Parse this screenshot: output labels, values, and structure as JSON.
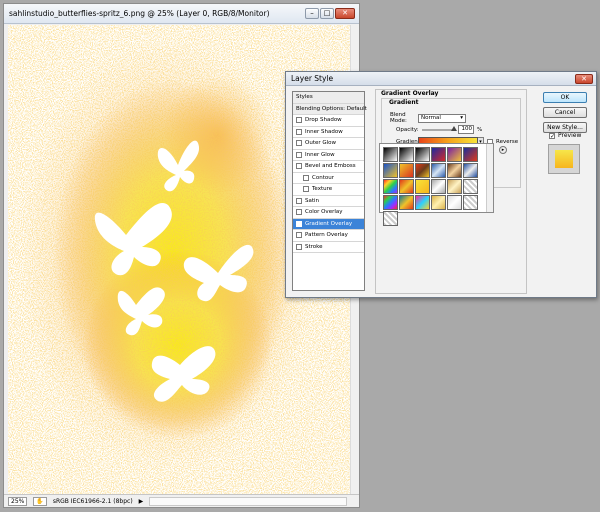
{
  "document": {
    "title": "sahlinstudio_butterflies-spritz_6.png @ 25% (Layer 0, RGB/8/Monitor)",
    "buttons": {
      "minimize": "–",
      "maximize": "□",
      "close": "✕"
    },
    "status": {
      "zoom": "25%",
      "profile": "sRGB IEC61966-2.1 (8bpc)",
      "arrow": "▶"
    }
  },
  "dialog": {
    "title": "Layer Style",
    "close": "✕",
    "styles_header": "Styles",
    "blending_options": "Blending Options: Default",
    "styles": [
      {
        "label": "Drop Shadow",
        "checked": false,
        "sub": false
      },
      {
        "label": "Inner Shadow",
        "checked": false,
        "sub": false
      },
      {
        "label": "Outer Glow",
        "checked": false,
        "sub": false
      },
      {
        "label": "Inner Glow",
        "checked": false,
        "sub": false
      },
      {
        "label": "Bevel and Emboss",
        "checked": false,
        "sub": false
      },
      {
        "label": "Contour",
        "checked": false,
        "sub": true
      },
      {
        "label": "Texture",
        "checked": false,
        "sub": true
      },
      {
        "label": "Satin",
        "checked": false,
        "sub": false
      },
      {
        "label": "Color Overlay",
        "checked": false,
        "sub": false
      },
      {
        "label": "Gradient Overlay",
        "checked": true,
        "sub": false,
        "selected": true
      },
      {
        "label": "Pattern Overlay",
        "checked": false,
        "sub": false
      },
      {
        "label": "Stroke",
        "checked": false,
        "sub": false
      }
    ],
    "panel_title": "Gradient Overlay",
    "group_title": "Gradient",
    "blend_mode_label": "Blend Mode:",
    "blend_mode_value": "Normal",
    "opacity_label": "Opacity:",
    "opacity_value": "100",
    "opacity_unit": "%",
    "gradient_label": "Gradient:",
    "reverse_label": "Reverse",
    "buttons": {
      "ok": "OK",
      "cancel": "Cancel",
      "new_style": "New Style...",
      "preview": "Preview"
    },
    "preview_checked": true,
    "gradient_swatches": [
      "linear-gradient(135deg,#000,#fff)",
      "linear-gradient(135deg,#000,#fff)",
      "linear-gradient(135deg,#000,transparent)",
      "linear-gradient(135deg,#1c2aa0,#d42b2b)",
      "linear-gradient(135deg,#7a1fa2,#f0c13a)",
      "linear-gradient(135deg,#1a2d9a,#e03a1a)",
      "linear-gradient(135deg,#1a54c9,#f0c22a)",
      "linear-gradient(135deg,#f0c22a,#d9331f)",
      "linear-gradient(135deg,#e03a1a,#6b3d1d,#f0c22a)",
      "linear-gradient(135deg,#2b5ba8,#d6e5f5,#2b5ba8)",
      "linear-gradient(135deg,#6b3d1d,#f3d2a0,#6b3d1d)",
      "linear-gradient(135deg,#2450a0,#eee,#2450a0)",
      "linear-gradient(135deg,#ff2a2a,#ffd22a,#2ad24a,#2a7aff,#a02aff)",
      "linear-gradient(135deg,#e03a1a,#f0c22a,#e03a1a)",
      "linear-gradient(135deg,#f7e33a,#f7b51d)",
      "linear-gradient(135deg,#a8a8a8,#fff,#a8a8a8)",
      "linear-gradient(135deg,#c8a15a,#fff3c4,#c8a15a)",
      "repeating-linear-gradient(45deg,#ccc 0 2px,#fff 2px 4px)",
      "linear-gradient(135deg,#ff2a2a,#2ad24a,#2a7aff,#a02aff,#ff2a2a)",
      "linear-gradient(135deg,#1c7a8f,#f0c22a,#e03a1a)",
      "linear-gradient(135deg,#ff2a9a,#2ad2ff,#ffd22a)",
      "linear-gradient(135deg,#d9b24a,#fff0b0,#d9b24a)",
      "linear-gradient(135deg,#ddd,#fff,#ddd)",
      "repeating-linear-gradient(45deg,#ccc 0 2px,#fff 2px 4px)",
      "repeating-linear-gradient(45deg,#ccc 0 2px,#fff 2px 4px)"
    ],
    "menu_icon": "▸"
  }
}
